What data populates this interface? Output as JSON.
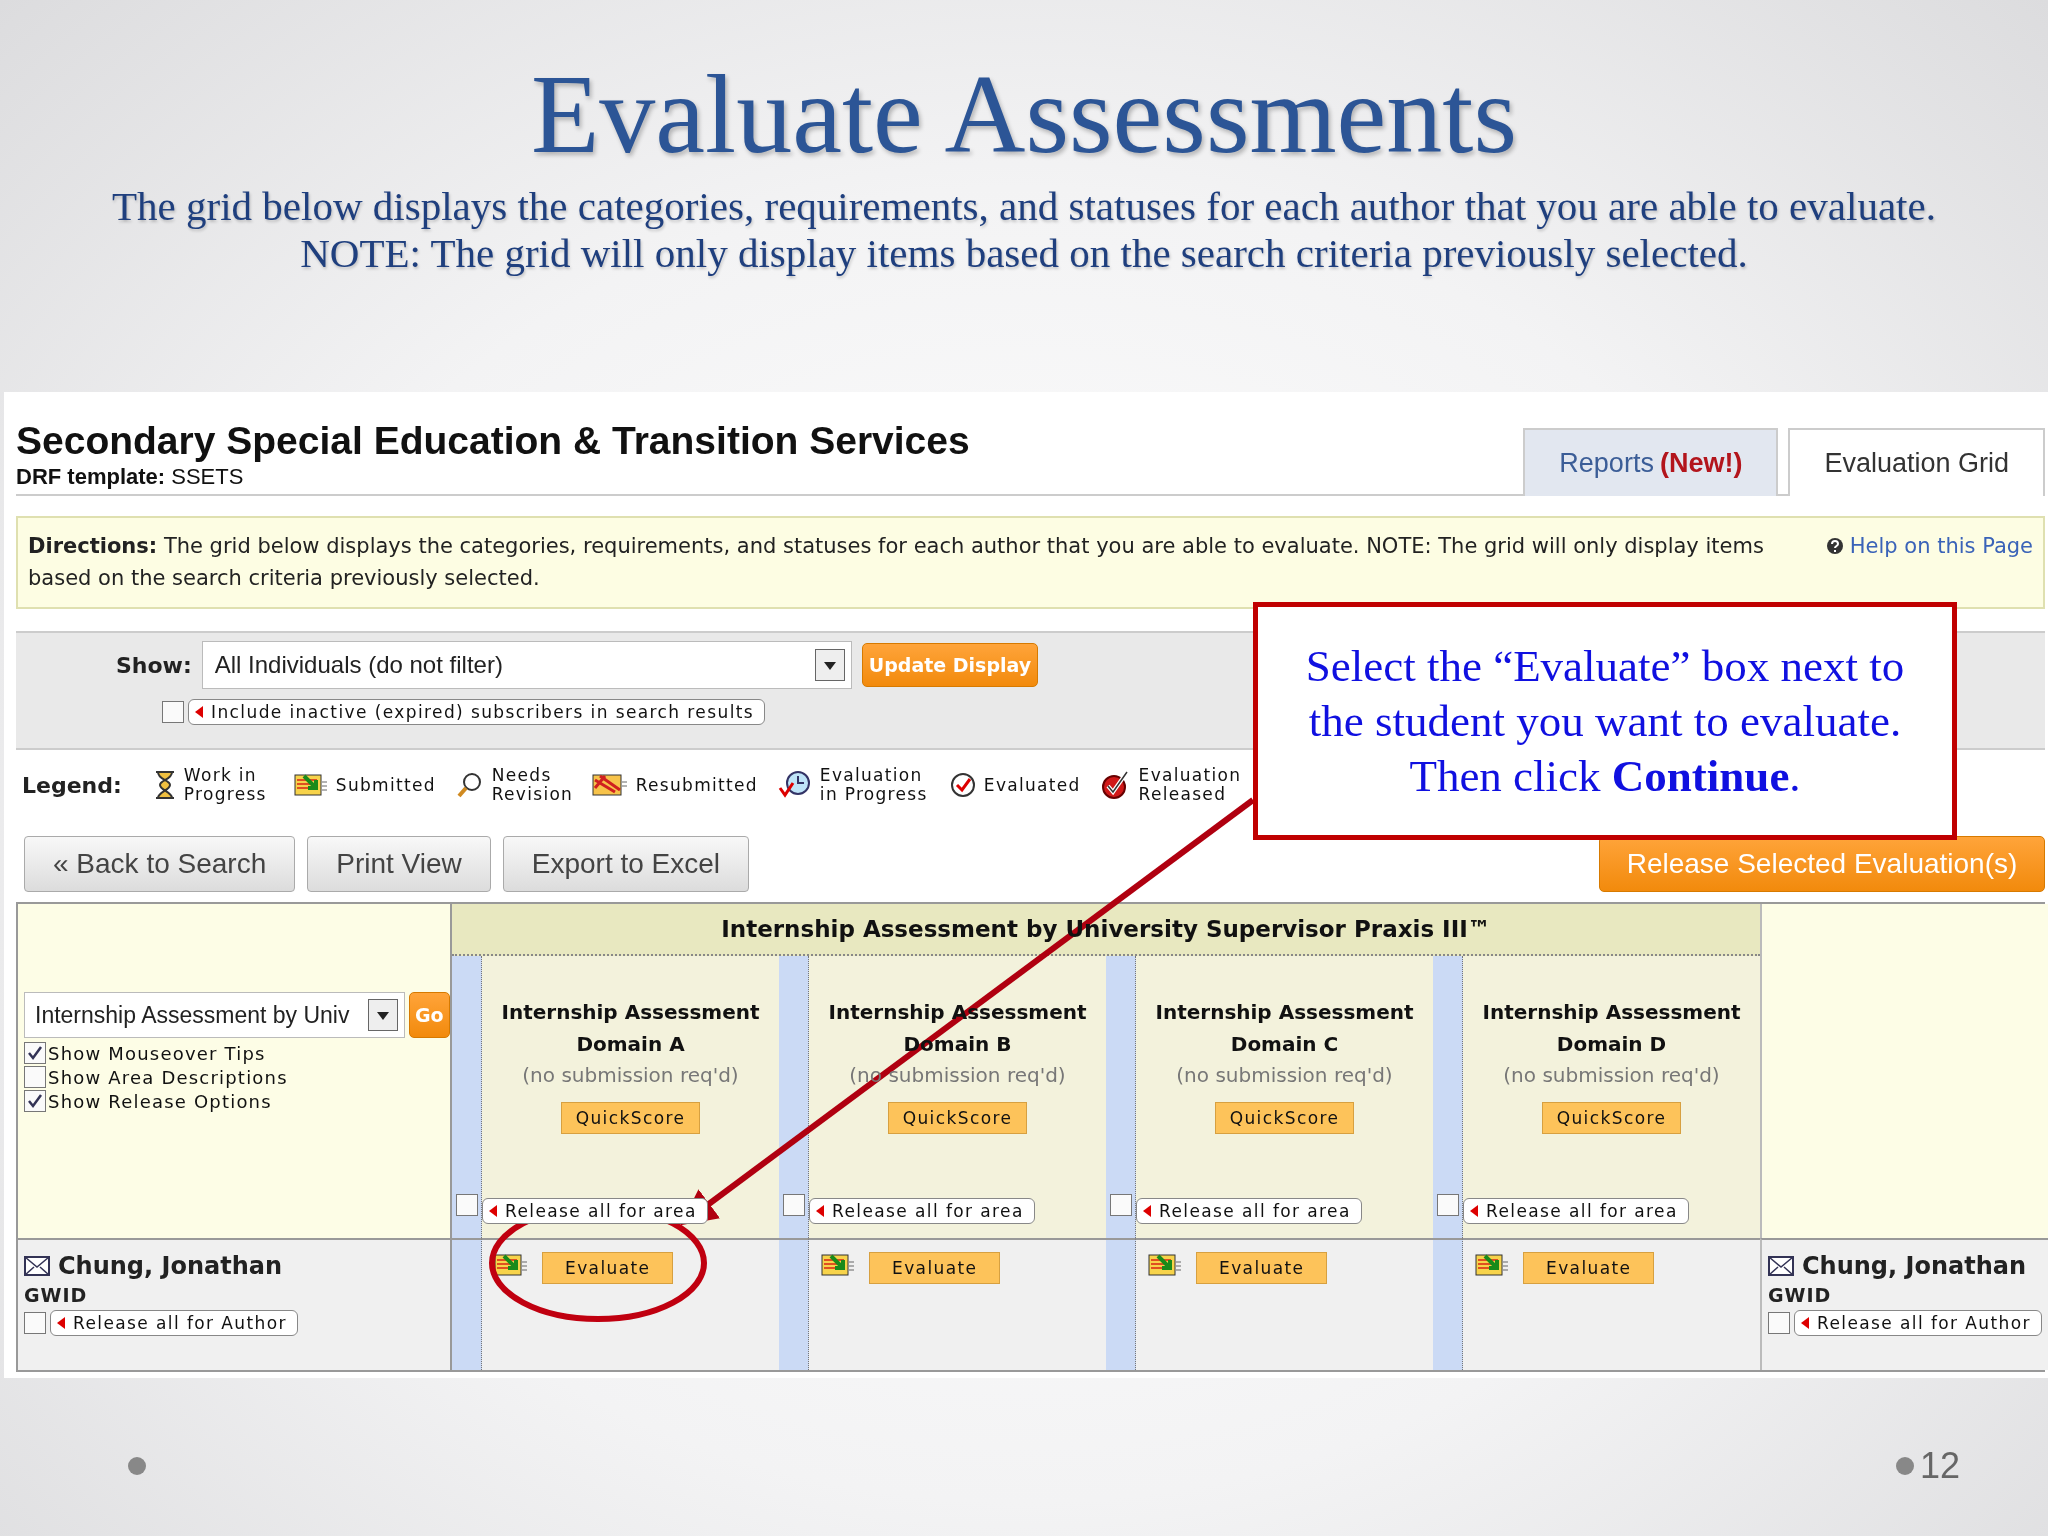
{
  "slide": {
    "title": "Evaluate Assessments",
    "subtitle": "The grid below displays the categories, requirements, and statuses for each author that you are able to evaluate. NOTE: The grid will only display items based on the search criteria previously selected.",
    "page_number": "12"
  },
  "app": {
    "heading": "Secondary Special Education & Transition Services",
    "template_label": "DRF template:",
    "template_value": "SSETS",
    "tabs": [
      {
        "label": "Reports",
        "badge": "(New!)",
        "selected": false
      },
      {
        "label": "Evaluation Grid",
        "selected": true
      }
    ],
    "directions": {
      "label": "Directions:",
      "text": "The grid below displays the categories, requirements, and statuses for each author that you are able to evaluate. NOTE: The grid will only display items based on the search criteria previously selected."
    },
    "help_link": "Help on this Page",
    "show": {
      "label": "Show:",
      "value": "All Individuals (do not filter)"
    },
    "update_button": "Update Display",
    "include_inactive": {
      "label": "Include inactive (expired) subscribers in search results",
      "checked": false
    },
    "legend": {
      "label": "Legend:",
      "items": [
        {
          "kind": "work_in_progress",
          "label": "Work in Progress"
        },
        {
          "kind": "submitted",
          "label": "Submitted"
        },
        {
          "kind": "needs_revision",
          "label": "Needs Revision"
        },
        {
          "kind": "resubmitted",
          "label": "Resubmitted"
        },
        {
          "kind": "evaluation_in_progress",
          "label": "Evaluation in Progress"
        },
        {
          "kind": "evaluated",
          "label": "Evaluated"
        },
        {
          "kind": "released",
          "label": "Evaluation Released"
        }
      ]
    },
    "buttons": [
      "« Back to Search",
      "Print View",
      "Export to Excel"
    ],
    "release_button": "Release Selected Evaluation(s)",
    "grid": {
      "group_title": "Internship Assessment by University Supervisor Praxis III™",
      "area_select": "Internship Assessment by Univ",
      "go_button": "Go",
      "options": [
        {
          "label": "Show Mouseover Tips",
          "checked": true
        },
        {
          "label": "Show Area Descriptions",
          "checked": false
        },
        {
          "label": "Show Release Options",
          "checked": true
        }
      ],
      "areas": [
        {
          "title": "Internship Assessment Domain A",
          "subtitle": "(no submission req'd)",
          "quickscore": "QuickScore",
          "release_label": "Release all for area",
          "checked": false
        },
        {
          "title": "Internship Assessment Domain B",
          "subtitle": "(no submission req'd)",
          "quickscore": "QuickScore",
          "release_label": "Release all for area",
          "checked": false
        },
        {
          "title": "Internship Assessment Domain C",
          "subtitle": "(no submission req'd)",
          "quickscore": "QuickScore",
          "release_label": "Release all for area",
          "checked": false
        },
        {
          "title": "Internship Assessment Domain D",
          "subtitle": "(no submission req'd)",
          "quickscore": "QuickScore",
          "release_label": "Release all for area",
          "checked": false
        }
      ],
      "author": {
        "name": "Chung, Jonathan",
        "id_label": "GWID",
        "release_label": "Release all for Author",
        "checked": false
      },
      "evaluate_buttons": [
        "Evaluate",
        "Evaluate",
        "Evaluate",
        "Evaluate"
      ],
      "author_right": {
        "name": "Chung, Jonathan",
        "id_label": "GWID",
        "release_label": "Release all for Author",
        "checked": false
      }
    }
  },
  "callout": {
    "text": "Select the “Evaluate” box next to the student you want to evaluate. Then click **Continue**."
  }
}
